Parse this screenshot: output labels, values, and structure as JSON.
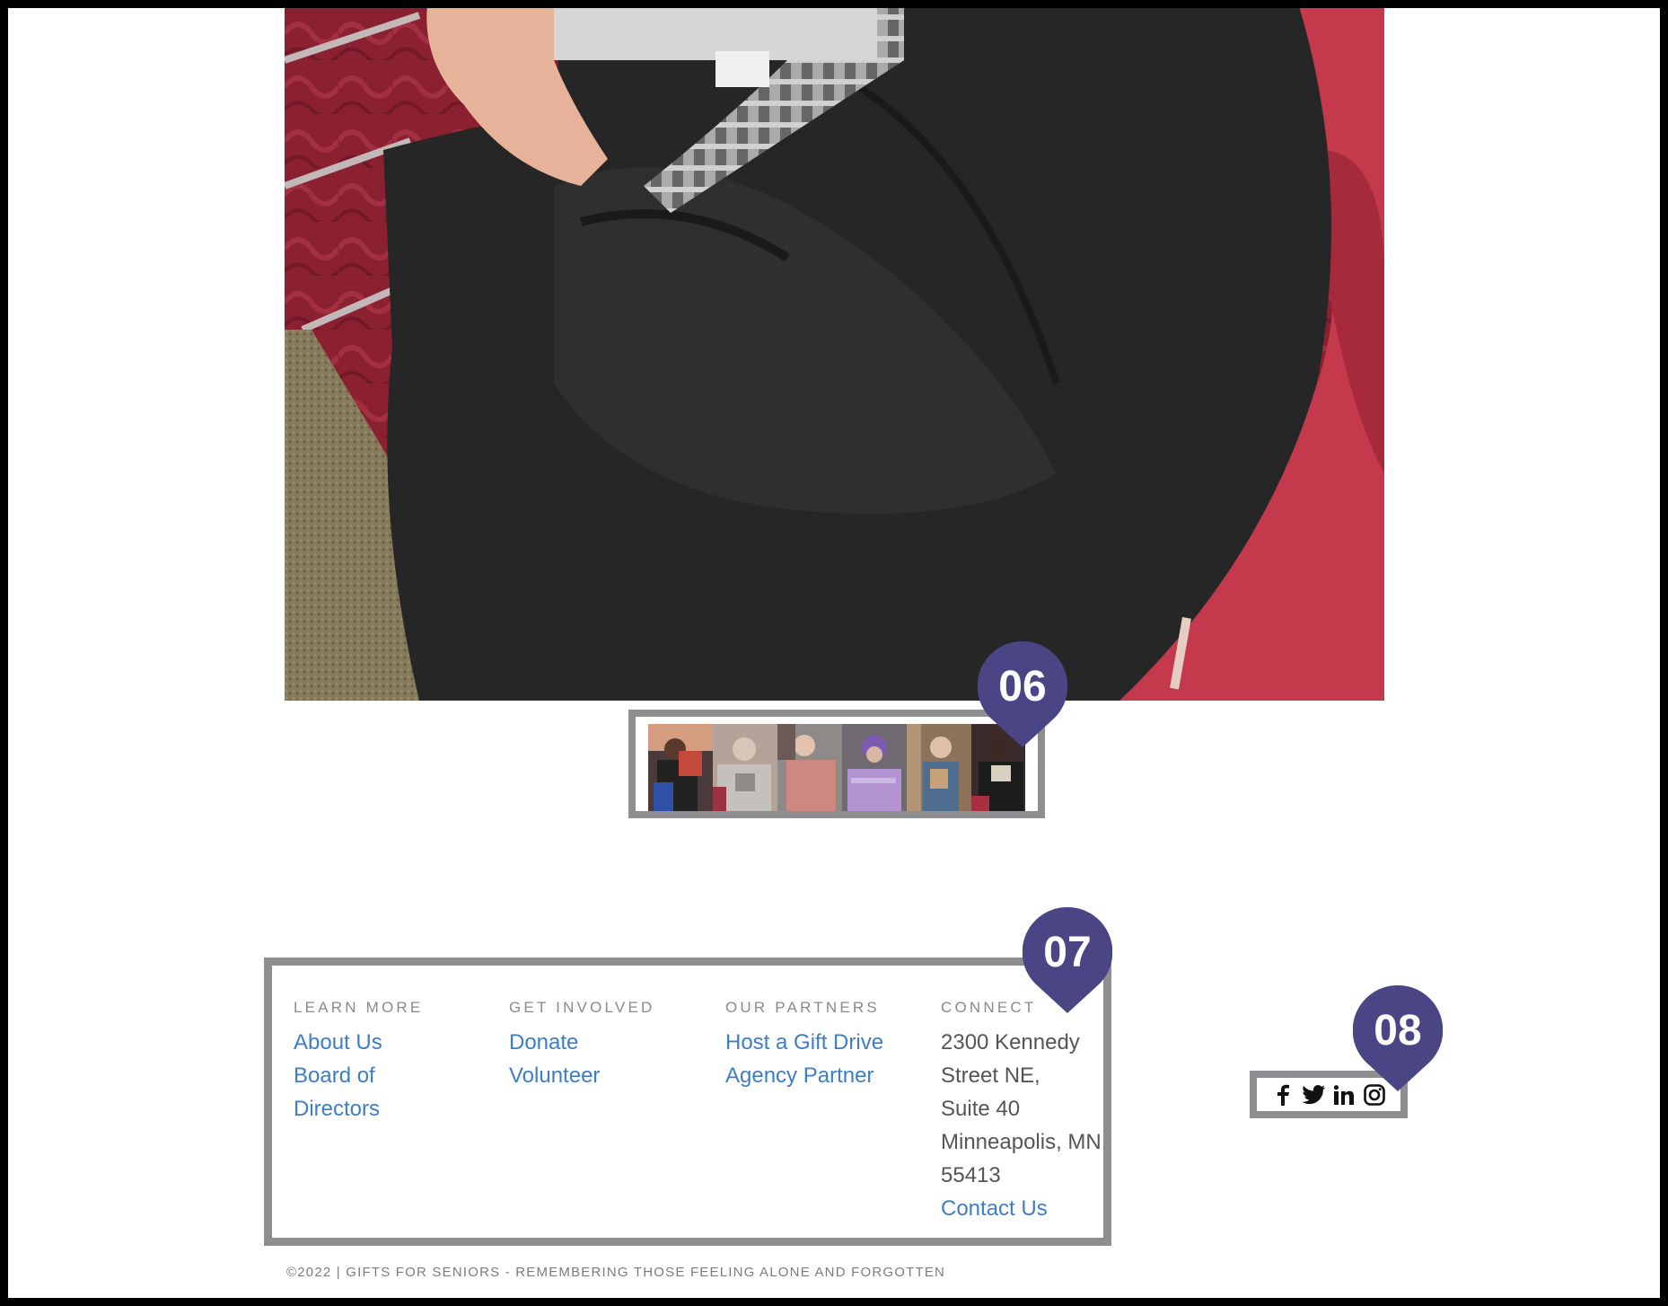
{
  "hero": {
    "icon": "hero-photo"
  },
  "thumbnails": {
    "count": 6
  },
  "markers": {
    "m06": "06",
    "m07": "07",
    "m08": "08",
    "color": "#4a4585"
  },
  "footer": {
    "learn_more": {
      "heading": "LEARN MORE",
      "links": [
        "About Us",
        "Board of",
        "Directors"
      ]
    },
    "get_involved": {
      "heading": "GET INVOLVED",
      "links": [
        "Donate",
        "Volunteer"
      ]
    },
    "our_partners": {
      "heading": "OUR PARTNERS",
      "links": [
        "Host a Gift Drive",
        "Agency Partner"
      ]
    },
    "connect": {
      "heading": "CONNECT",
      "address": [
        "2300 Kennedy",
        "Street NE,",
        "Suite 40",
        "Minneapolis, MN",
        "55413"
      ],
      "contact": "Contact Us"
    }
  },
  "social": [
    "facebook-icon",
    "twitter-icon",
    "linkedin-icon",
    "instagram-icon"
  ],
  "copyright": "©2022 | GIFTS FOR SENIORS - REMEMBERING THOSE FEELING ALONE AND FORGOTTEN",
  "colors": {
    "link": "#3c7ec8",
    "border": "#8e8d90",
    "marker": "#4a4585"
  }
}
